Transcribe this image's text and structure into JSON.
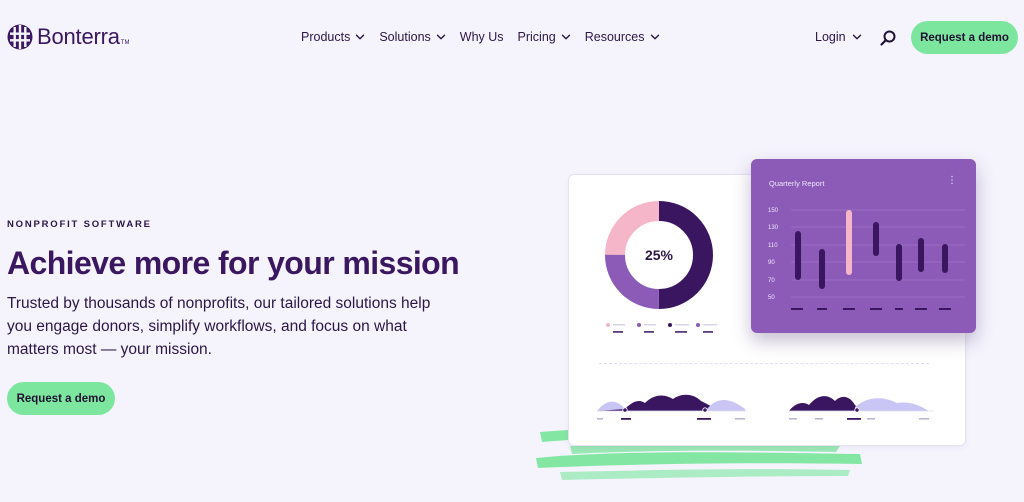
{
  "header": {
    "logo_text": "Bonterra",
    "logo_tm": "TM",
    "nav": [
      {
        "label": "Products",
        "has_menu": true
      },
      {
        "label": "Solutions",
        "has_menu": true
      },
      {
        "label": "Why Us",
        "has_menu": false
      },
      {
        "label": "Pricing",
        "has_menu": true
      },
      {
        "label": "Resources",
        "has_menu": true
      }
    ],
    "login_label": "Login",
    "search_icon": "search-icon",
    "cta_label": "Request a demo"
  },
  "hero": {
    "eyebrow": "NONPROFIT SOFTWARE",
    "title": "Achieve more for your mission",
    "subtitle": "Trusted by thousands of nonprofits, our tailored solutions help you engage donors, simplify workflows, and focus on what matters most — your mission.",
    "cta_label": "Request a demo"
  },
  "illustration": {
    "donut": {
      "label": "25%"
    },
    "report": {
      "title": "Quarterly Report",
      "menu_icon": "⋮",
      "y_ticks": [
        "150",
        "130",
        "110",
        "90",
        "70",
        "50"
      ]
    }
  },
  "colors": {
    "background": "#f5f4fd",
    "brand_dark": "#3a1760",
    "accent_green": "#7ce69e",
    "purple_card": "#8c5bb8",
    "donut_pink": "#f4b6c8",
    "donut_purple": "#8c5bb8",
    "donut_dark": "#3b1660"
  }
}
